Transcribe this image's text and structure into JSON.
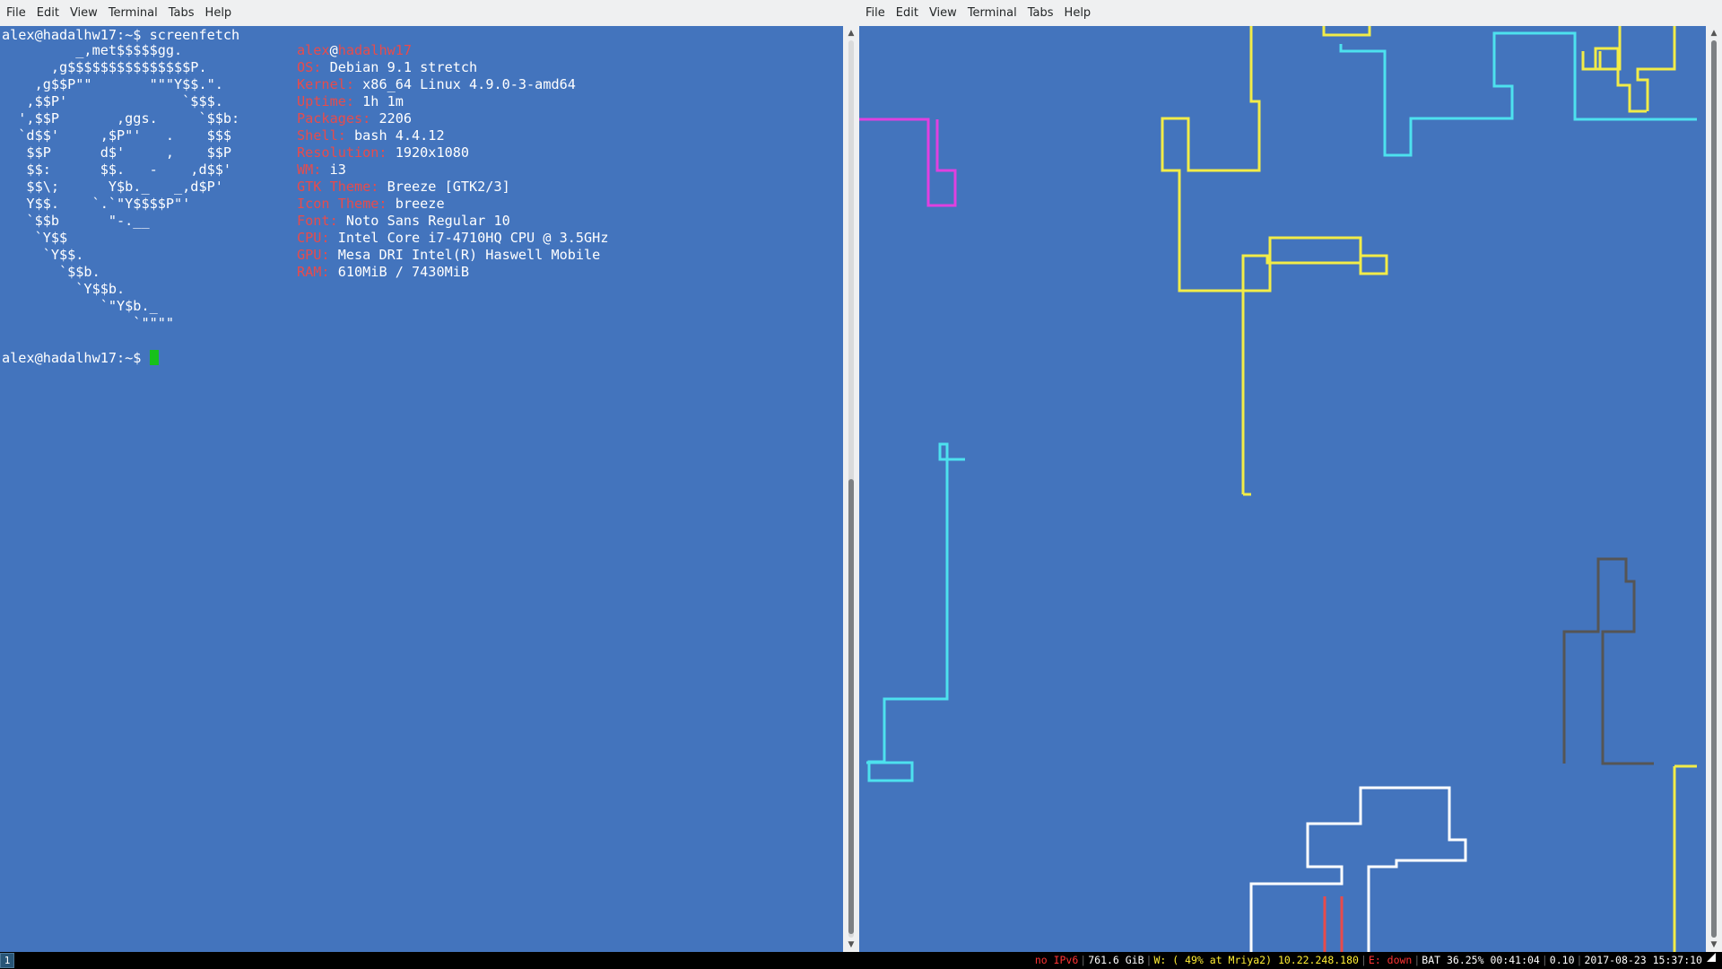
{
  "menu": [
    "File",
    "Edit",
    "View",
    "Terminal",
    "Tabs",
    "Help"
  ],
  "left_terminal": {
    "prompt": "alex@hadalhw17:~$",
    "command": "screenfetch",
    "ascii_art": [
      "         _,met$$$$$gg.",
      "      ,g$$$$$$$$$$$$$$$P.",
      "    ,g$$P\"\"       \"\"\"Y$$.\".",
      "   ,$$P'              `$$$.",
      "  ',$$P       ,ggs.     `$$b:",
      "  `d$$'     ,$P\"'   .    $$$",
      "   $$P      d$'     ,    $$P",
      "   $$:      $$.   -    ,d$$'",
      "   $$\\;      Y$b._   _,d$P'",
      "   Y$$.    `.`\"Y$$$$P\"'",
      "   `$$b      \"-.__",
      "    `Y$$",
      "     `Y$$.",
      "       `$$b.",
      "         `Y$$b.",
      "            `\"Y$b._",
      "                `\"\"\"\""
    ],
    "user": "alex",
    "at": "@",
    "host": "hadalhw17",
    "info": [
      {
        "label": "OS:",
        "value": "Debian 9.1 stretch"
      },
      {
        "label": "Kernel:",
        "value": "x86_64 Linux 4.9.0-3-amd64"
      },
      {
        "label": "Uptime:",
        "value": "1h 1m"
      },
      {
        "label": "Packages:",
        "value": "2206"
      },
      {
        "label": "Shell:",
        "value": "bash 4.4.12"
      },
      {
        "label": "Resolution:",
        "value": "1920x1080"
      },
      {
        "label": "WM:",
        "value": "i3"
      },
      {
        "label": "GTK Theme:",
        "value": "Breeze [GTK2/3]"
      },
      {
        "label": "Icon Theme:",
        "value": "breeze"
      },
      {
        "label": "Font:",
        "value": "Noto Sans Regular 10"
      },
      {
        "label": "CPU:",
        "value": "Intel Core i7-4710HQ CPU @ 3.5GHz"
      },
      {
        "label": "GPU:",
        "value": "Mesa DRI Intel(R) Haswell Mobile"
      },
      {
        "label": "RAM:",
        "value": "610MiB / 7430MiB"
      }
    ],
    "prompt2": "alex@hadalhw17:~$"
  },
  "status_bar": {
    "workspace": "1",
    "ipv6": "no IPv6",
    "disk": "761.6 GiB",
    "wifi": "W: ( 49% at Mriya2) 10.22.248.180",
    "ethernet": "E: down",
    "battery": "BAT 36.25% 00:41:04",
    "load": "0.10",
    "datetime": "2017-08-23 15:37:10"
  },
  "colors": {
    "terminal_bg": "#4374bd",
    "label": "#e84b4b",
    "cursor": "#17c11a",
    "pipe_yellow": "#f2ec48",
    "pipe_cyan": "#4de1ee",
    "pipe_magenta": "#e040e0",
    "pipe_white": "#ffffff",
    "pipe_gray": "#555555",
    "pipe_red": "#e84b4b"
  }
}
